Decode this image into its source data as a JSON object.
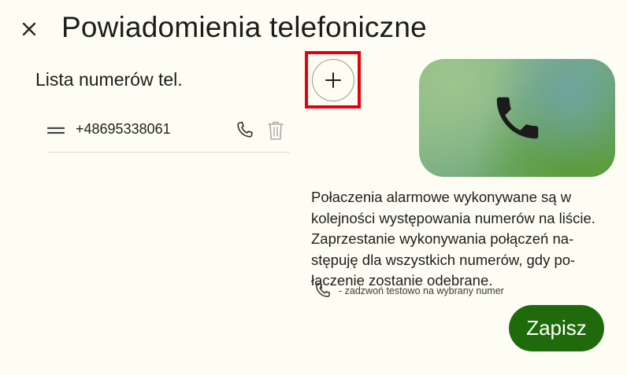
{
  "dialog": {
    "title": "Powiadomienia telefoniczne",
    "close_icon": "close-icon"
  },
  "list": {
    "heading": "Lista numerów tel.",
    "add_icon": "plus-icon",
    "numbers": [
      {
        "number": "+48695338061"
      }
    ]
  },
  "hero": {
    "icon": "phone-icon"
  },
  "description": {
    "lines": [
      "Połaczenia alarmowe wykonywane są w",
      "kolejności występowania numerów na liście.",
      "Zaprzestanie wykonywania połączeń na-",
      "stępuję dla wszystkich numerów, gdy po-",
      "łączenie zostanie odebrane."
    ],
    "legend_text": "- zadzwoń testowo na wybrany numer"
  },
  "actions": {
    "save_label": "Zapisz"
  },
  "colors": {
    "background": "#fdfdf3",
    "accent": "#1f6b0c",
    "highlight": "#e4000f"
  }
}
